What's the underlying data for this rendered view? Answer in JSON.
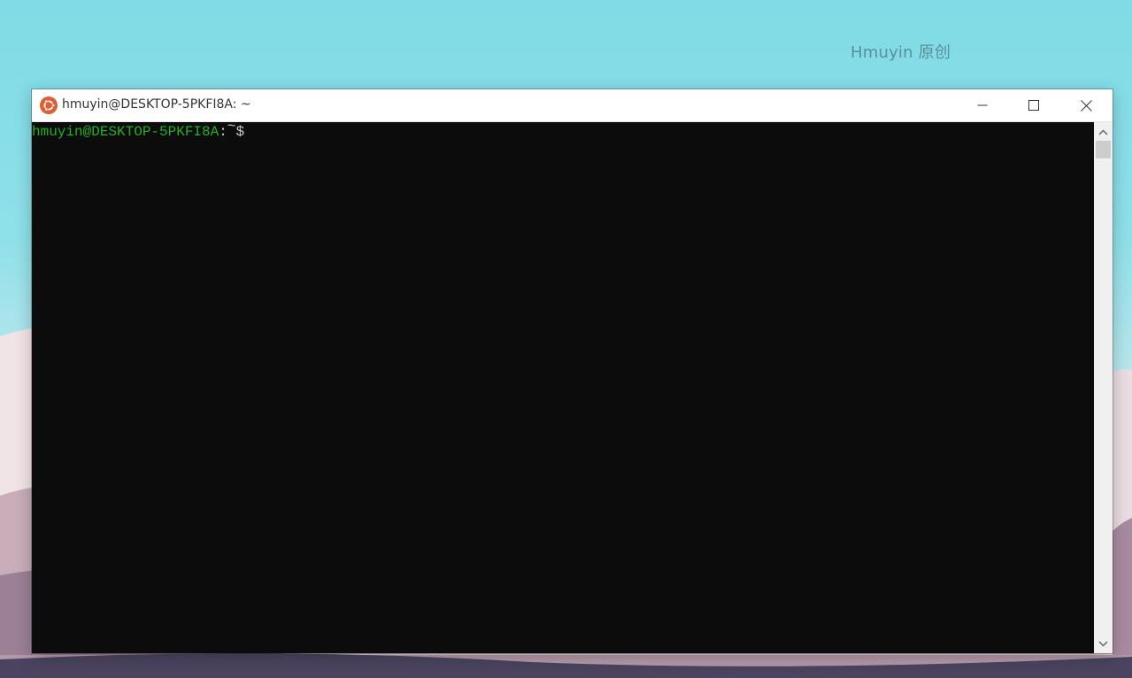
{
  "desktop": {
    "watermark": "Hmuyin 原创"
  },
  "window": {
    "title": "hmuyin@DESKTOP-5PKFI8A: ~",
    "icon": "ubuntu-icon",
    "controls": {
      "minimize": "minimize-icon",
      "maximize": "maximize-icon",
      "close": "close-icon"
    }
  },
  "terminal": {
    "prompt_user_host": "hmuyin@DESKTOP-5PKFI8A",
    "prompt_colon": ":",
    "prompt_cwd": "~",
    "prompt_symbol": "$ "
  },
  "colors": {
    "prompt_green": "#23b023",
    "terminal_bg": "#0c0c0c",
    "ubuntu_orange": "#dd5e36"
  }
}
